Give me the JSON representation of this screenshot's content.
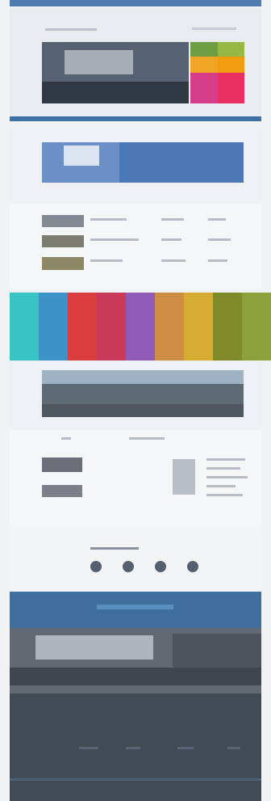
{
  "hero": {
    "swatches": [
      {
        "color": "#6f9f42"
      },
      {
        "color": "#96b845"
      },
      {
        "color": "#f0a526"
      },
      {
        "color": "#f29b0e"
      },
      {
        "color": "#d63e8a"
      },
      {
        "color": "#ea2f62"
      }
    ]
  },
  "banner": {},
  "list": {},
  "colors": {
    "strip": [
      "#3ac3c5",
      "#3b93c8",
      "#db3d3f",
      "#c93958",
      "#8e5bb7",
      "#ce8c44",
      "#d5ab31",
      "#7f8b2b",
      "#8ca03c"
    ]
  },
  "landscape": {},
  "details": {},
  "icons": {
    "items": [
      "play-icon",
      "chat-icon",
      "settings-icon",
      "share-icon"
    ]
  },
  "footer": {
    "brand": {
      "accent": "#3d6fa8",
      "dark": "#3f4a54"
    }
  }
}
